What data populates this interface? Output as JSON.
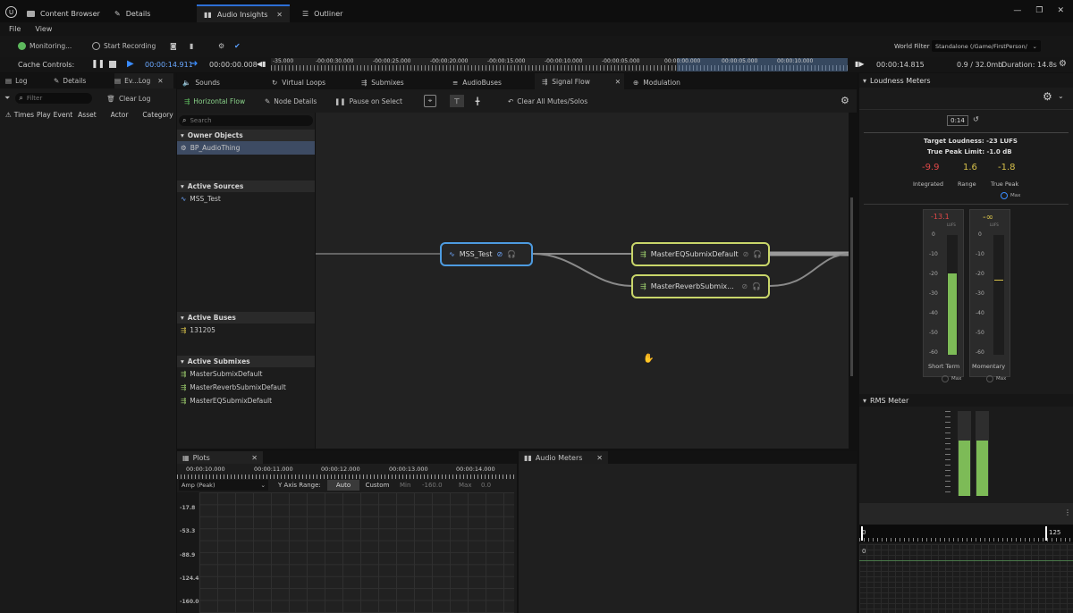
{
  "title_tabs": [
    {
      "label": "Content Browser",
      "icon": "folder-icon"
    },
    {
      "label": "Details",
      "icon": "pencil-icon"
    },
    {
      "label": "Audio Insights",
      "icon": "audio-icon"
    },
    {
      "label": "Outliner",
      "icon": "outliner-icon"
    }
  ],
  "menu": [
    "File",
    "View"
  ],
  "toolbar": {
    "monitoring": "Monitoring...",
    "start_recording": "Start Recording",
    "world_filter_label": "World Filter",
    "world_filter_value": "Standalone (/Game/FirstPerson/"
  },
  "cache": {
    "label": "Cache Controls:",
    "current_time": "00:00:14.911",
    "start_time": "00:00:00.008",
    "end_time": "00:00:14.815",
    "memory": "0.9 / 32.0mb",
    "duration": "Duration: 14.8s",
    "ruler": [
      "-35.000",
      "-00:00:30.000",
      "-00:00:25.000",
      "-00:00:20.000",
      "-00:00:15.000",
      "-00:00:10.000",
      "-00:00:05.000",
      "00:00:00.000",
      "00:00:05.000",
      "00:00:10.000"
    ]
  },
  "left": {
    "tabs": [
      "Log",
      "Details",
      "Ev...Log"
    ],
    "filter_placeholder": "Filter",
    "clear_log": "Clear Log",
    "columns": [
      "Times",
      "Play",
      "Event",
      "Asset",
      "Actor",
      "Category"
    ]
  },
  "main_tabs": [
    "Sounds",
    "Virtual Loops",
    "Submixes",
    "AudioBuses",
    "Signal Flow",
    "Modulation"
  ],
  "signal_flow": {
    "horizontal_flow": "Horizontal Flow",
    "node_details": "Node Details",
    "pause_on_select": "Pause on Select",
    "clear_mutes": "Clear All Mutes/Solos",
    "search_placeholder": "Search",
    "owner_objects_header": "Owner Objects",
    "owner_objects": [
      "BP_AudioThing"
    ],
    "active_sources_header": "Active Sources",
    "active_sources": [
      "MSS_Test"
    ],
    "active_buses_header": "Active Buses",
    "active_buses": [
      "131205"
    ],
    "active_submixes_header": "Active Submixes",
    "active_submixes": [
      "MasterSubmixDefault",
      "MasterReverbSubmixDefault",
      "MasterEQSubmixDefault"
    ],
    "nodes": {
      "source": "MSS_Test",
      "eq": "MasterEQSubmixDefault",
      "reverb": "MasterReverbSubmix..."
    }
  },
  "plots": {
    "tab": "Plots",
    "times": [
      "00:00:10.000",
      "00:00:11.000",
      "00:00:12.000",
      "00:00:13.000",
      "00:00:14.000"
    ],
    "select_value": "Amp (Peak)",
    "y_axis_label": "Y Axis Range:",
    "auto": "Auto",
    "custom": "Custom",
    "min_label": "Min",
    "min_value": "-160.0",
    "max_label": "Max",
    "max_value": "0.0",
    "y_ticks": [
      "-17.8",
      "-53.3",
      "-88.9",
      "-124.4",
      "-160.0"
    ]
  },
  "audio_meters": {
    "tab": "Audio Meters"
  },
  "loudness": {
    "header": "Loudness Meters",
    "time": "0:14",
    "target": "Target Loudness: -23 LUFS",
    "true_peak_limit": "True Peak Limit: -1.0 dB",
    "integrated_value": "-9.9",
    "range_value": "1.6",
    "true_peak_value": "-1.8",
    "integrated_label": "Integrated",
    "range_label": "Range",
    "true_peak_label": "True Peak",
    "max_label": "Max",
    "short_term_value": "-13.1",
    "momentary_value": "-∞",
    "lufs_unit": "LUFS",
    "scale": [
      "0",
      "-10",
      "-20",
      "-30",
      "-40",
      "-50",
      "-60"
    ],
    "short_term_label": "Short Term",
    "momentary_label": "Momentary",
    "short_term_level": 0.68,
    "momentary_level": 0.0
  },
  "rms": {
    "header": "RMS Meter",
    "timeline_end": "125",
    "timeline_start": "0",
    "lower_value": "0",
    "channel_left_level": 0.65,
    "channel_right_level": 0.65
  },
  "colors": {
    "accent": "#2d6fd6",
    "meter_green": "#7dbb57",
    "loudness_red": "#e04848",
    "node_source_border": "#4d9be0",
    "node_submix_border": "#c9d66a"
  }
}
